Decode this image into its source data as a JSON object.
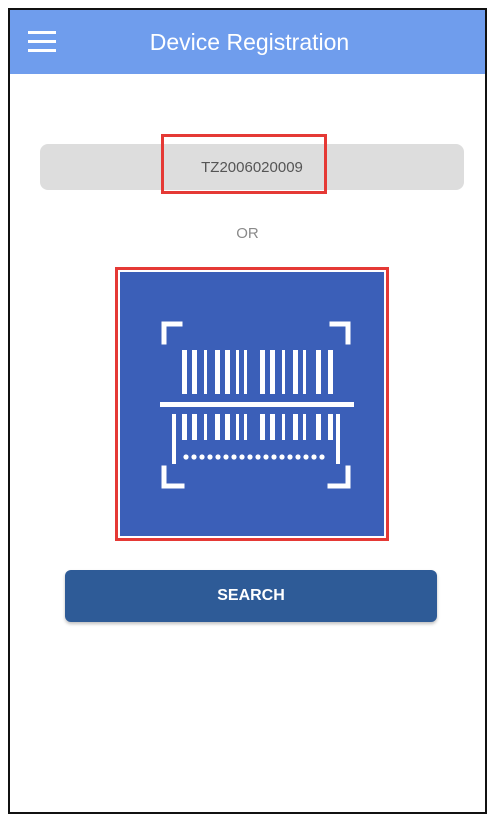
{
  "app": {
    "title": "Device Registration"
  },
  "header": {
    "menu_icon": "hamburger-menu-icon"
  },
  "form": {
    "device_id_value": "TZ2006020009",
    "or_label": "OR",
    "scan_icon": "barcode-scan-icon",
    "search_label": "SEARCH"
  },
  "colors": {
    "appbar": "#6f9ded",
    "scan_button": "#3b5fb8",
    "search_button": "#2e5b97",
    "highlight": "#e53935",
    "input_background": "#dddddd"
  }
}
